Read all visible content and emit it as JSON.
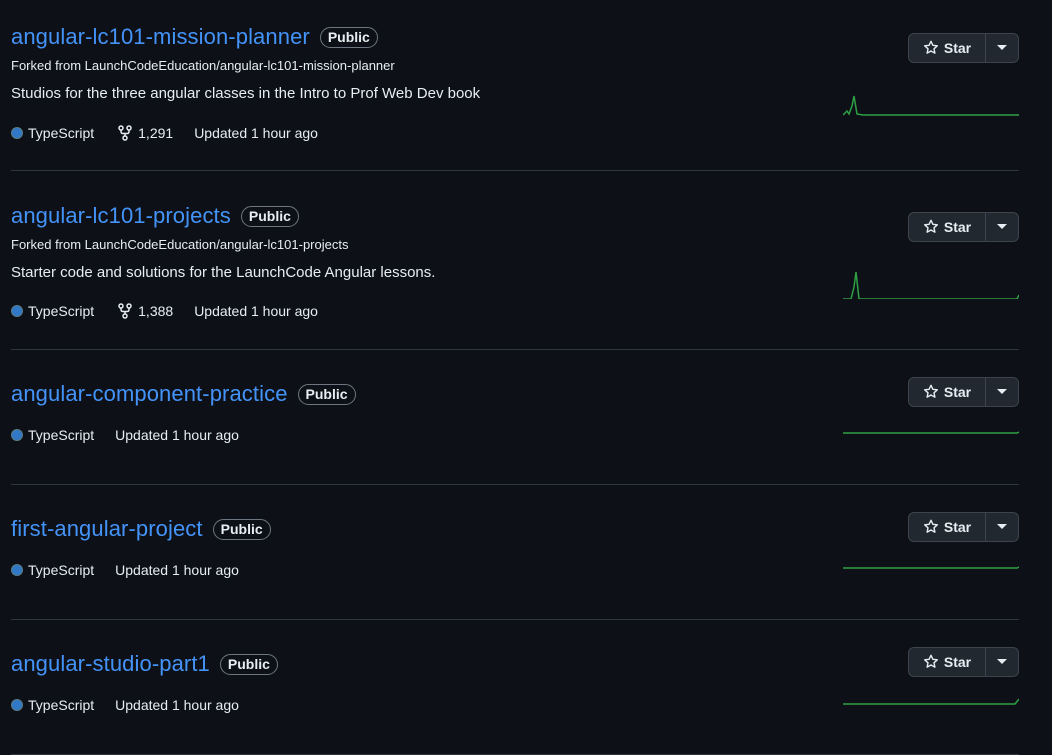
{
  "colors": {
    "link": "#4493f8",
    "typescript": "#3178c6",
    "spark": "#2ea043"
  },
  "icons": {
    "star": "star-icon",
    "dropdown": "triangle-down-icon",
    "fork": "repo-forked-icon"
  },
  "repos": [
    {
      "name": "angular-lc101-mission-planner",
      "visibility": "Public",
      "forked_from": "Forked from LaunchCodeEducation/angular-lc101-mission-planner",
      "description": "Studios for the three angular classes in the Intro to Prof Web Dev book",
      "language": "TypeScript",
      "forks": "1,291",
      "updated": "Updated 1 hour ago",
      "star_label": "Star"
    },
    {
      "name": "angular-lc101-projects",
      "visibility": "Public",
      "forked_from": "Forked from LaunchCodeEducation/angular-lc101-projects",
      "description": "Starter code and solutions for the LaunchCode Angular lessons.",
      "language": "TypeScript",
      "forks": "1,388",
      "updated": "Updated 1 hour ago",
      "star_label": "Star"
    },
    {
      "name": "angular-component-practice",
      "visibility": "Public",
      "language": "TypeScript",
      "updated": "Updated 1 hour ago",
      "star_label": "Star"
    },
    {
      "name": "first-angular-project",
      "visibility": "Public",
      "language": "TypeScript",
      "updated": "Updated 1 hour ago",
      "star_label": "Star"
    },
    {
      "name": "angular-studio-part1",
      "visibility": "Public",
      "language": "TypeScript",
      "updated": "Updated 1 hour ago",
      "star_label": "Star"
    }
  ]
}
